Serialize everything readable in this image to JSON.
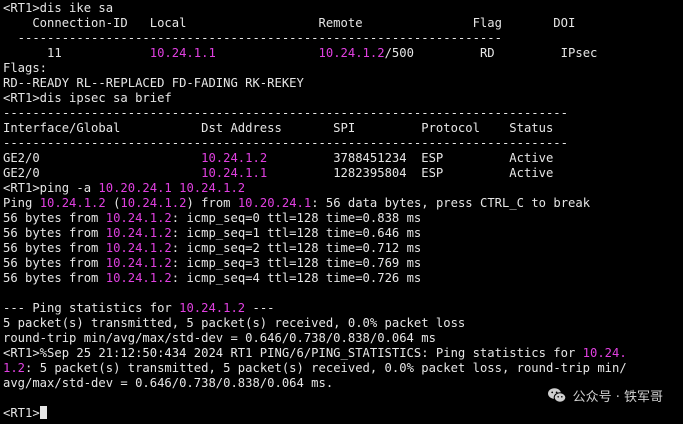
{
  "colors": {
    "background": "#000000",
    "text": "#e6e6e6",
    "ip_highlight": "#e040e0"
  },
  "terminal": {
    "lines": [
      [
        {
          "t": "<RT1>dis ike sa"
        }
      ],
      [
        {
          "t": "    Connection-ID   Local                  Remote               Flag       DOI"
        }
      ],
      [
        {
          "t": "  ------------------------------------------------------------------"
        }
      ],
      [
        {
          "t": "      11            "
        },
        {
          "t": "10.24.1.1",
          "ip": true
        },
        {
          "t": "              "
        },
        {
          "t": "10.24.1.2",
          "ip": true
        },
        {
          "t": "/500         RD         IPsec"
        }
      ],
      [
        {
          "t": "Flags:"
        }
      ],
      [
        {
          "t": "RD--READY RL--REPLACED FD-FADING RK-REKEY"
        }
      ],
      [
        {
          "t": "<RT1>dis ipsec sa brief"
        }
      ],
      [
        {
          "t": "-----------------------------------------------------------------------------"
        }
      ],
      [
        {
          "t": "Interface/Global           Dst Address       SPI         Protocol    Status"
        }
      ],
      [
        {
          "t": "-----------------------------------------------------------------------------"
        }
      ],
      [
        {
          "t": "GE2/0                      "
        },
        {
          "t": "10.24.1.2",
          "ip": true
        },
        {
          "t": "         3788451234  ESP         Active"
        }
      ],
      [
        {
          "t": "GE2/0                      "
        },
        {
          "t": "10.24.1.1",
          "ip": true
        },
        {
          "t": "         1282395804  ESP         Active"
        }
      ],
      [
        {
          "t": "<RT1>ping -a "
        },
        {
          "t": "10.20.24.1",
          "ip": true
        },
        {
          "t": " "
        },
        {
          "t": "10.24.1.2",
          "ip": true
        }
      ],
      [
        {
          "t": "Ping "
        },
        {
          "t": "10.24.1.2",
          "ip": true
        },
        {
          "t": " ("
        },
        {
          "t": "10.24.1.2",
          "ip": true
        },
        {
          "t": ") from "
        },
        {
          "t": "10.20.24.1",
          "ip": true
        },
        {
          "t": ": 56 data bytes, press CTRL_C to break"
        }
      ],
      [
        {
          "t": "56 bytes from "
        },
        {
          "t": "10.24.1.2",
          "ip": true
        },
        {
          "t": ": icmp_seq=0 ttl=128 time=0.838 ms"
        }
      ],
      [
        {
          "t": "56 bytes from "
        },
        {
          "t": "10.24.1.2",
          "ip": true
        },
        {
          "t": ": icmp_seq=1 ttl=128 time=0.646 ms"
        }
      ],
      [
        {
          "t": "56 bytes from "
        },
        {
          "t": "10.24.1.2",
          "ip": true
        },
        {
          "t": ": icmp_seq=2 ttl=128 time=0.712 ms"
        }
      ],
      [
        {
          "t": "56 bytes from "
        },
        {
          "t": "10.24.1.2",
          "ip": true
        },
        {
          "t": ": icmp_seq=3 ttl=128 time=0.769 ms"
        }
      ],
      [
        {
          "t": "56 bytes from "
        },
        {
          "t": "10.24.1.2",
          "ip": true
        },
        {
          "t": ": icmp_seq=4 ttl=128 time=0.726 ms"
        }
      ],
      [
        {
          "t": ""
        }
      ],
      [
        {
          "t": "--- Ping statistics for "
        },
        {
          "t": "10.24.1.2",
          "ip": true
        },
        {
          "t": " ---"
        }
      ],
      [
        {
          "t": "5 packet(s) transmitted, 5 packet(s) received, 0.0% packet loss"
        }
      ],
      [
        {
          "t": "round-trip min/avg/max/std-dev = 0.646/0.738/0.838/0.064 ms"
        }
      ],
      [
        {
          "t": "<RT1>%Sep 25 21:12:50:434 2024 RT1 PING/6/PING_STATISTICS: Ping statistics for "
        },
        {
          "t": "10.24.",
          "ip": true
        }
      ],
      [
        {
          "t": "1.2",
          "ip": true
        },
        {
          "t": ": 5 packet(s) transmitted, 5 packet(s) received, 0.0% packet loss, round-trip min/"
        }
      ],
      [
        {
          "t": "avg/max/std-dev = 0.646/0.738/0.838/0.064 ms."
        }
      ],
      [
        {
          "t": ""
        }
      ],
      [
        {
          "t": "<RT1>"
        }
      ]
    ]
  },
  "watermark": {
    "icon": "wechat-icon",
    "text": "公众号 · 铁军哥"
  }
}
